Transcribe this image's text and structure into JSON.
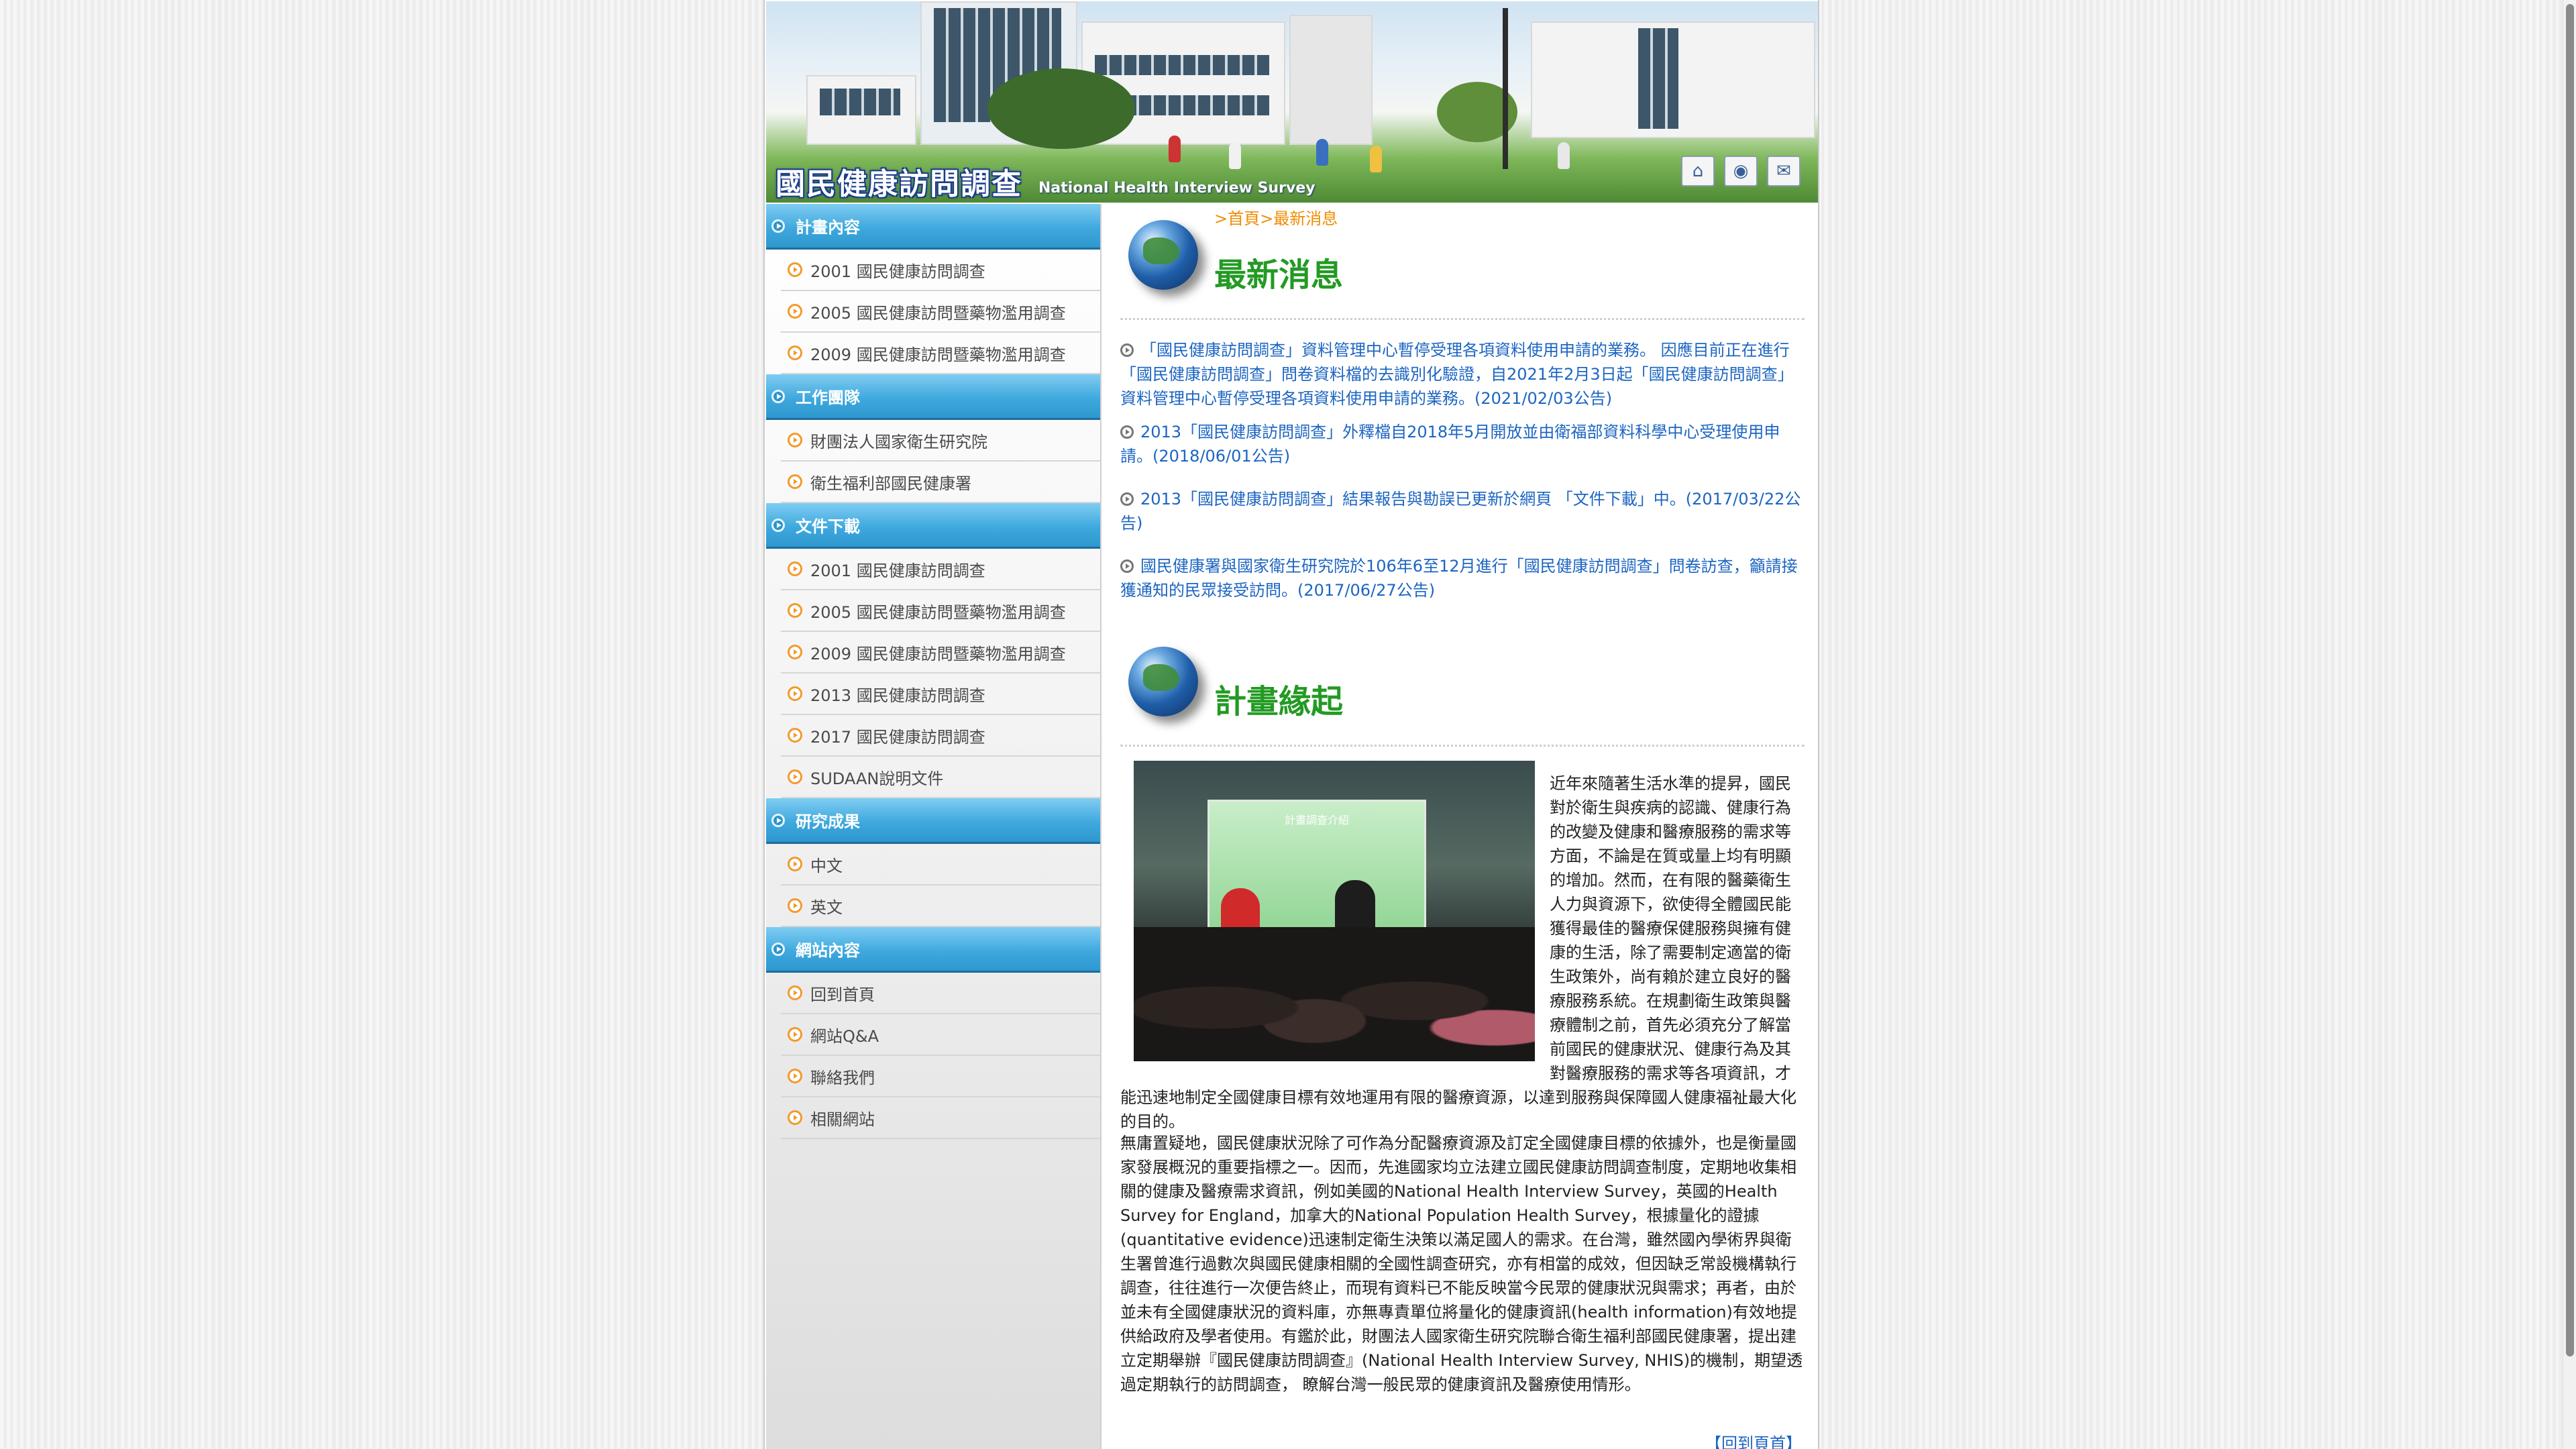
{
  "banner": {
    "title": "國民健康訪問調查",
    "subtitle": "National Health Interview Survey",
    "icons": [
      "home-icon",
      "globe-icon",
      "mail-icon"
    ]
  },
  "sidebar": {
    "sections": [
      {
        "title": "計畫內容",
        "items": [
          "2001 國民健康訪問調查",
          "2005 國民健康訪問暨藥物濫用調查",
          "2009 國民健康訪問暨藥物濫用調查"
        ]
      },
      {
        "title": "工作團隊",
        "items": [
          "財團法人國家衛生研究院",
          "衛生福利部國民健康署"
        ]
      },
      {
        "title": "文件下載",
        "items": [
          "2001 國民健康訪問調查",
          "2005 國民健康訪問暨藥物濫用調查",
          "2009 國民健康訪問暨藥物濫用調查",
          "2013 國民健康訪問調查",
          "2017 國民健康訪問調查",
          "SUDAAN說明文件"
        ]
      },
      {
        "title": "研究成果",
        "items": [
          "中文",
          "英文"
        ]
      },
      {
        "title": "網站內容",
        "items": [
          "回到首頁",
          "網站Q&A",
          "聯絡我們",
          "相關網站"
        ]
      }
    ]
  },
  "content": {
    "breadcrumb": ">首頁>最新消息",
    "news_title": "最新消息",
    "news": [
      "「國民健康訪問調查」資料管理中心暫停受理各項資料使用申請的業務。 因應目前正在進行「國民健康訪問調查」問卷資料檔的去識別化驗證，自2021年2月3日起「國民健康訪問調查」資料管理中心暫停受理各項資料使用申請的業務。(2021/02/03公告)",
      "2013「國民健康訪問調查」外釋檔自2018年5月開放並由衛福部資料科學中心受理使用申請。(2018/06/01公告)",
      "2013「國民健康訪問調查」結果報告與勘誤已更新於網頁 「文件下載」中。(2017/03/22公告)",
      "國民健康署與國家衛生研究院於106年6至12月進行「國民健康訪問調查」問卷訪查，籲請接獲通知的民眾接受訪問。(2017/06/27公告)"
    ],
    "origin_title": "計畫緣起",
    "photo_screen_text": "計畫調查介紹",
    "paragraph1": "近年來隨著生活水準的提昇，國民對於衛生與疾病的認識、健康行為的改變及健康和醫療服務的需求等方面，不論是在質或量上均有明顯的增加。然而，在有限的醫藥衛生人力與資源下，欲使得全體國民能獲得最佳的醫療保健服務與擁有健康的生活，除了需要制定適當的衛生政策外，尚有賴於建立良好的醫療服務系統。在規劃衛生政策與醫療體制之前，首先必須充分了解當前國民的健康狀況、健康行為及其對醫療服務的需求等各項資訊，才能迅速地制定全國健康目標有效地運用有限的醫療資源，以達到服務與保障國人健康福祉最大化的目的。",
    "paragraph2": "無庸置疑地，國民健康狀況除了可作為分配醫療資源及訂定全國健康目標的依據外，也是衡量國家發展概況的重要指標之一。因而，先進國家均立法建立國民健康訪問調查制度，定期地收集相關的健康及醫療需求資訊，例如美國的National Health Interview Survey，英國的Health Survey for England，加拿大的National Population Health Survey，根據量化的證據(quantitative evidence)迅速制定衛生決策以滿足國人的需求。在台灣，雖然國內學術界與衛生署曾進行過數次與國民健康相關的全國性調查研究，亦有相當的成效，但因缺乏常設機構執行調查，往往進行一次便告終止，而現有資料已不能反映當今民眾的健康狀況與需求；再者，由於並未有全國健康狀況的資料庫，亦無專責單位將量化的健康資訊(health information)有效地提供給政府及學者使用。有鑑於此，財團法人國家衛生研究院聯合衛生福利部國民健康署，提出建立定期舉辦『國民健康訪問調查』(National Health Interview Survey, NHIS)的機制，期望透過定期執行的訪問調查， 瞭解台灣一般民眾的健康資訊及醫療使用情形。",
    "back_to_top": "【回到頁首】"
  }
}
